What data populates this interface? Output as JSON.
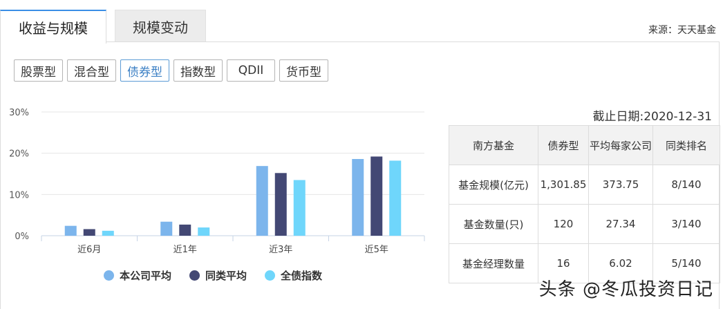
{
  "tabs": [
    {
      "label": "收益与规模",
      "active": true
    },
    {
      "label": "规模变动",
      "active": false
    }
  ],
  "source": "来源：天天基金",
  "fund_types": [
    {
      "label": "股票型",
      "selected": false
    },
    {
      "label": "混合型",
      "selected": false
    },
    {
      "label": "债券型",
      "selected": true
    },
    {
      "label": "指数型",
      "selected": false
    },
    {
      "label": "QDII",
      "selected": false
    },
    {
      "label": "货币型",
      "selected": false
    }
  ],
  "as_of": "截止日期:2020-12-31",
  "table": {
    "headers": [
      "南方基金",
      "债券型",
      "平均每家公司",
      "同类排名"
    ],
    "rows": [
      [
        "基金规模(亿元)",
        "1,301.85",
        "373.75",
        "8/140"
      ],
      [
        "基金数量(只)",
        "120",
        "27.34",
        "3/140"
      ],
      [
        "基金经理数量",
        "16",
        "6.02",
        "5/140"
      ]
    ]
  },
  "chart_data": {
    "type": "bar",
    "categories": [
      "近6月",
      "近1年",
      "近3年",
      "近5年"
    ],
    "series": [
      {
        "name": "本公司平均",
        "color": "#7cb5ec",
        "values": [
          2.4,
          3.4,
          16.9,
          18.6
        ]
      },
      {
        "name": "同类平均",
        "color": "#434874",
        "values": [
          1.6,
          2.7,
          15.2,
          19.2
        ]
      },
      {
        "name": "全债指数",
        "color": "#6fd6fb",
        "values": [
          1.2,
          2.0,
          13.5,
          18.2
        ]
      }
    ],
    "yticks": [
      "0%",
      "10%",
      "20%",
      "30%"
    ],
    "ylim": [
      0,
      30
    ],
    "grid": true,
    "legend": "bottom"
  },
  "watermark": "头条 @冬瓜投资日记"
}
